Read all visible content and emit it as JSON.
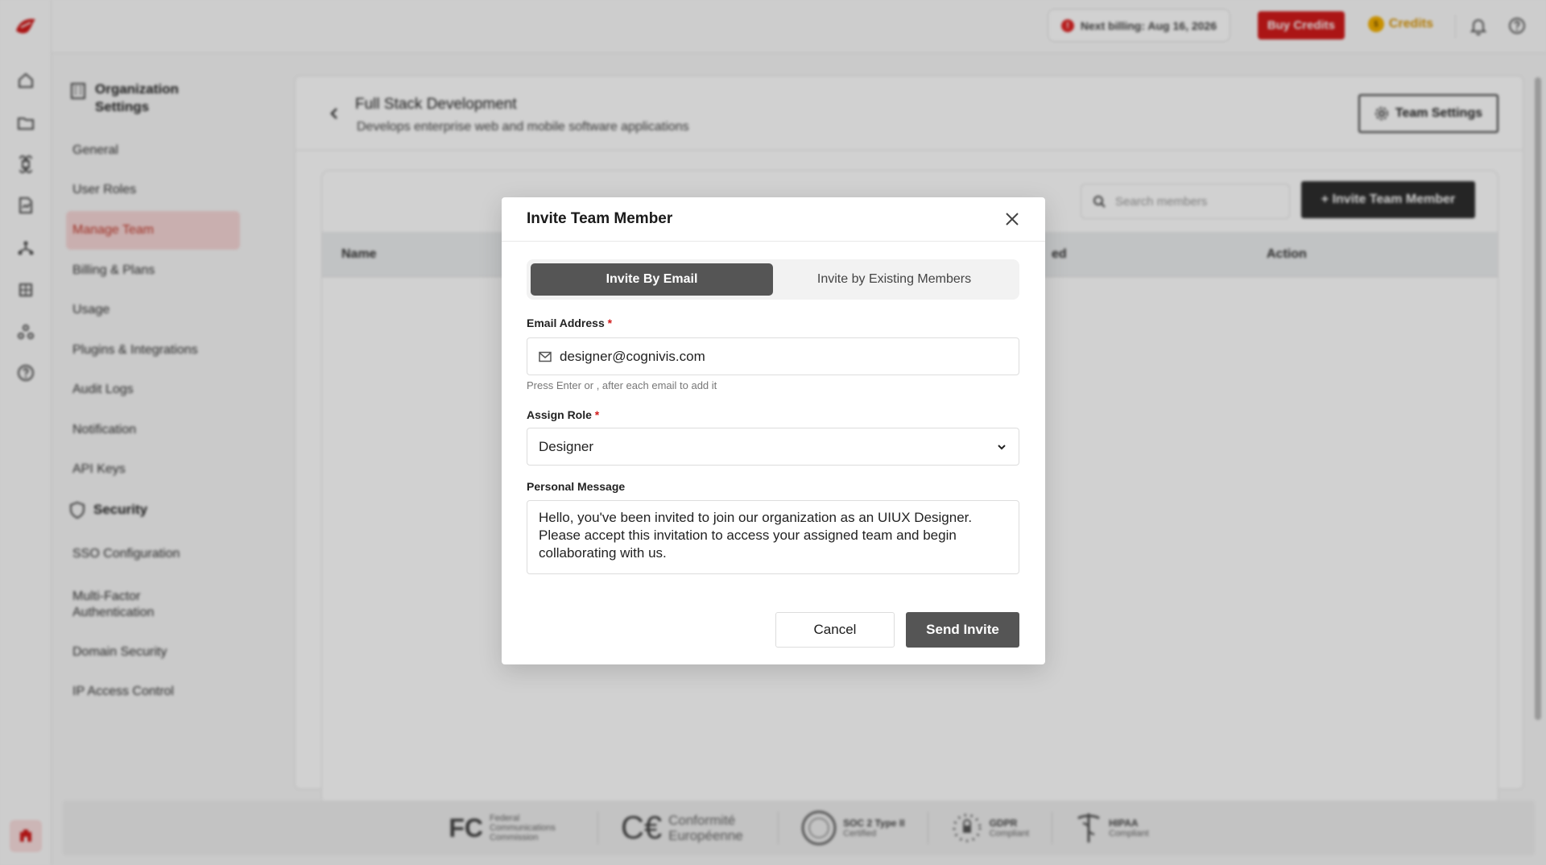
{
  "topbar": {
    "billing_label": "Next billing: Aug 16, 2026",
    "buy_credits_label": "Buy Credits",
    "credits_label": "Credits",
    "coin_symbol": "$"
  },
  "settings_nav": {
    "heading": "Organization Settings",
    "items": [
      {
        "label": "General"
      },
      {
        "label": "User Roles"
      },
      {
        "label": "Manage Team"
      },
      {
        "label": "Billing & Plans"
      },
      {
        "label": "Usage"
      },
      {
        "label": "Plugins & Integrations"
      },
      {
        "label": "Audit Logs"
      },
      {
        "label": "Notification"
      },
      {
        "label": "API Keys"
      }
    ],
    "security_heading": "Security",
    "security_items": [
      {
        "label": "SSO Configuration"
      },
      {
        "label": "Multi-Factor Authentication"
      },
      {
        "label": "Domain Security"
      },
      {
        "label": "IP Access Control"
      }
    ]
  },
  "team": {
    "title": "Full Stack Development",
    "description": "Develops enterprise web and mobile software applications",
    "settings_button": "Team Settings",
    "search_placeholder": "Search members",
    "invite_button": "+ Invite Team Member",
    "columns": {
      "name": "Name",
      "partial": "ed",
      "action": "Action"
    }
  },
  "compliance": {
    "fcc_mark": "FC",
    "fcc_text": "Federal Communications Commission",
    "ce_mark": "C€",
    "ce_text": "Conformité Européenne",
    "soc_text": "SOC 2 Type II",
    "soc_sub": "Certified",
    "gdpr_text": "GDPR",
    "gdpr_sub": "Compliant",
    "hipaa_text": "HIPAA",
    "hipaa_sub": "Compliant"
  },
  "modal": {
    "title": "Invite Team Member",
    "tab_email": "Invite By Email",
    "tab_existing": "Invite by Existing Members",
    "email_label": "Email Address",
    "email_value": "designer@cognivis.com",
    "email_hint": "Press Enter or , after each email to add it",
    "role_label": "Assign Role",
    "role_value": "Designer",
    "message_label": "Personal Message",
    "message_value": "Hello, you've been invited to join our organization as an UIUX Designer. Please accept this invitation to access your assigned team and begin collaborating with us.",
    "required_mark": "*",
    "cancel_label": "Cancel",
    "send_label": "Send Invite"
  },
  "colors": {
    "brand_red": "#d11a1a",
    "credits_gold": "#d99400",
    "active_nav_bg": "#f6d6d6",
    "modal_primary": "#555555"
  }
}
